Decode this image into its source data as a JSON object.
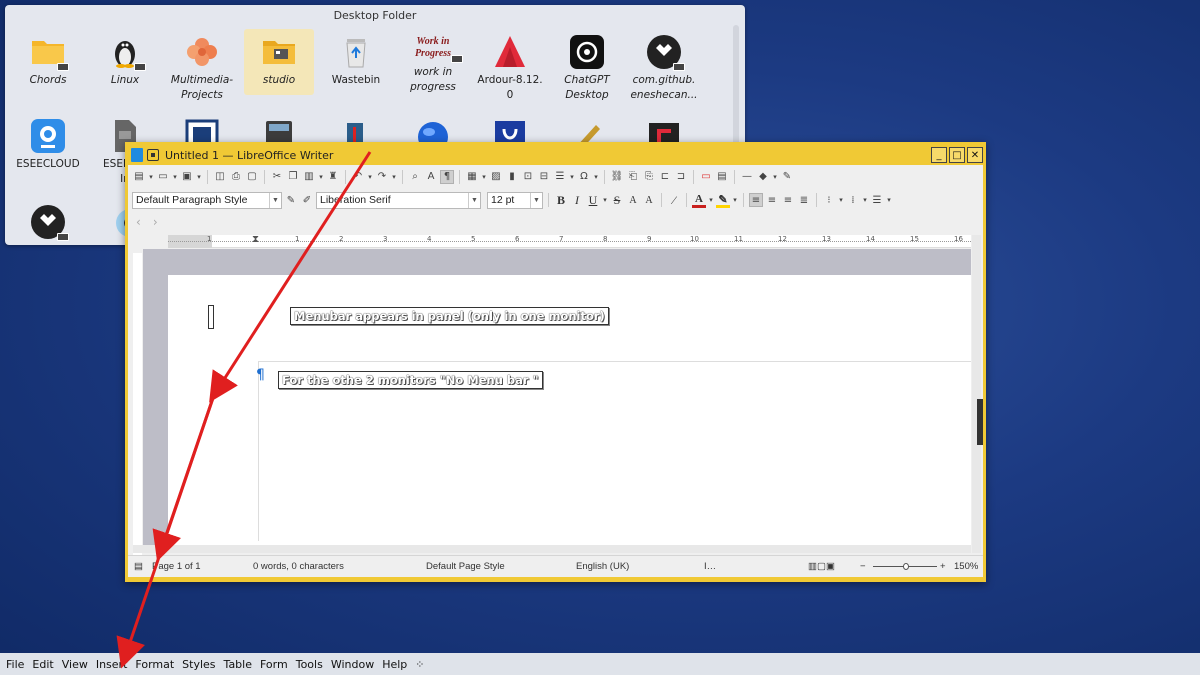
{
  "folder": {
    "title": "Desktop Folder",
    "items": [
      {
        "label": "Chords",
        "icon": "folder-icon"
      },
      {
        "label": "Linux",
        "icon": "tux-icon"
      },
      {
        "label": "Multimedia-\nProjects",
        "icon": "flower-icon"
      },
      {
        "label": "studio",
        "icon": "studio-folder-icon"
      },
      {
        "label": "Wastebin",
        "icon": "wastebin-icon"
      },
      {
        "label": "work in\nprogress",
        "icon": "work-in-progress-icon"
      },
      {
        "label": "Ardour-8.12.\n0",
        "icon": "ardour-icon"
      },
      {
        "label": "ChatGPT\nDesktop",
        "icon": "chatgpt-icon"
      },
      {
        "label": "com.github.\neneshecan...",
        "icon": "tidal-icon"
      },
      {
        "label": "ESEECLOUD",
        "icon": "webcam-icon"
      },
      {
        "label": "ESEEC...\nIn",
        "icon": "file-icon"
      }
    ],
    "wip_art": "Work in\nProgress"
  },
  "writer": {
    "title": "Untitled 1 — LibreOffice Writer",
    "paragraph_style": "Default Paragraph Style",
    "font_name": "Liberation Serif",
    "font_size": "12 pt",
    "ruler_numbers": [
      "1",
      "1",
      "2",
      "3",
      "4",
      "5",
      "6",
      "7",
      "8",
      "9",
      "10",
      "11",
      "12",
      "13",
      "14",
      "15",
      "16"
    ],
    "annotation_1": "Menubar appears in panel  (only in one monitor)",
    "annotation_2": "For the othe 2 monitors  \"No Menu bar \"",
    "status": {
      "page": "Page 1 of 1",
      "words": "0 words, 0 characters",
      "page_style": "Default Page Style",
      "language": "English (UK)",
      "zoom": "150%"
    }
  },
  "panel": {
    "menu": [
      "File",
      "Edit",
      "View",
      "Insert",
      "Format",
      "Styles",
      "Table",
      "Form",
      "Tools",
      "Window",
      "Help"
    ]
  },
  "colors": {
    "arrow": "#e01f1f",
    "writer_frame": "#f0c935",
    "desktop": "#1c3a82"
  }
}
